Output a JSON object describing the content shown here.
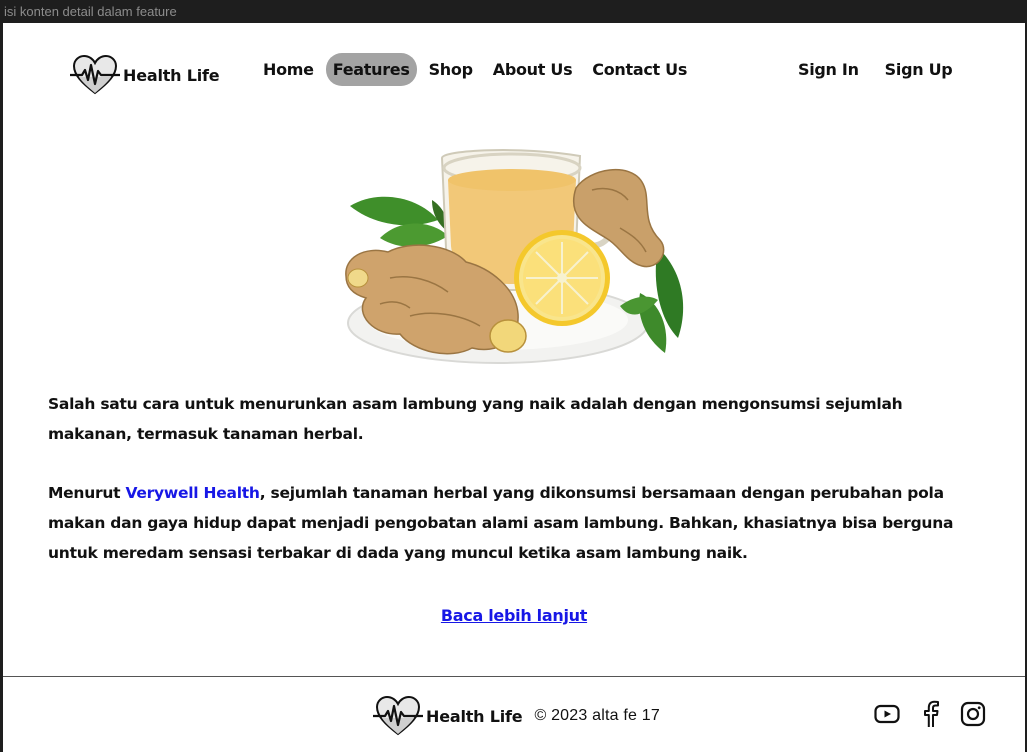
{
  "window": {
    "title": "isi konten detail dalam feature"
  },
  "brand": {
    "name": "Health Life",
    "icon": "heart-pulse-icon"
  },
  "nav": {
    "items": [
      {
        "label": "Home",
        "active": false
      },
      {
        "label": "Features",
        "active": true
      },
      {
        "label": "Shop",
        "active": false
      },
      {
        "label": "About Us",
        "active": false
      },
      {
        "label": "Contact Us",
        "active": false
      }
    ],
    "active_bg": "#a3a3a3"
  },
  "auth": {
    "sign_in": "Sign In",
    "sign_up": "Sign Up"
  },
  "article": {
    "image": "ginger-tea-lemon-image",
    "paragraph1": "Salah satu cara untuk menurunkan asam lambung yang naik adalah dengan mengonsumsi sejumlah makanan, termasuk tanaman herbal.",
    "paragraph2_prefix": "Menurut ",
    "paragraph2_link": "Verywell Health",
    "paragraph2_rest": ", sejumlah tanaman herbal yang dikonsumsi bersamaan dengan perubahan pola makan dan gaya hidup dapat menjadi pengobatan alami asam lambung. Bahkan, khasiatnya bisa berguna untuk meredam sensasi terbakar di dada yang muncul ketika asam lambung naik.",
    "read_more": "Baca lebih lanjut",
    "link_color": "#1717e6"
  },
  "footer": {
    "brand": "Health Life",
    "copyright": "© 2023 alta fe 17",
    "socials": [
      "youtube-icon",
      "facebook-icon",
      "instagram-icon"
    ]
  }
}
